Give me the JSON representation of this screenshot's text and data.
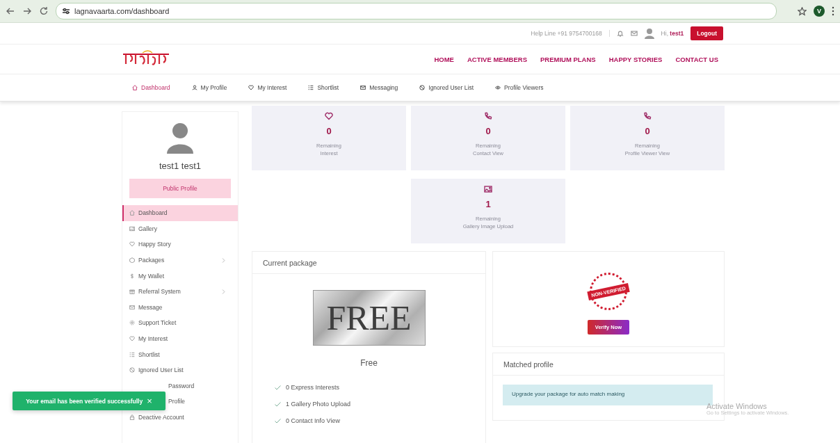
{
  "browser": {
    "url": "lagnavaarta.com/dashboard",
    "profile_initial": "V"
  },
  "top_bar": {
    "helpline": "Help Line +91 9754700168",
    "greeting": "Hi, ",
    "username": "test1",
    "logout": "Logout"
  },
  "nav": {
    "links": [
      "HOME",
      "ACTIVE MEMBERS",
      "PREMIUM PLANS",
      "HAPPY STORIES",
      "CONTACT US"
    ]
  },
  "sub_nav": [
    {
      "label": "Dashboard",
      "selected": true
    },
    {
      "label": "My Profile",
      "selected": false
    },
    {
      "label": "My Interest",
      "selected": false
    },
    {
      "label": "Shortlist",
      "selected": false
    },
    {
      "label": "Messaging",
      "selected": false
    },
    {
      "label": "Ignored User List",
      "selected": false
    },
    {
      "label": "Profile Viewers",
      "selected": false
    }
  ],
  "sidebar": {
    "name": "test1 test1",
    "public_profile": "Public Profile",
    "items": [
      {
        "label": "Dashboard",
        "selected": true,
        "has_submenu": false
      },
      {
        "label": "Gallery",
        "selected": false,
        "has_submenu": false
      },
      {
        "label": "Happy Story",
        "selected": false,
        "has_submenu": false
      },
      {
        "label": "Packages",
        "selected": false,
        "has_submenu": true
      },
      {
        "label": "My Wallet",
        "selected": false,
        "has_submenu": false
      },
      {
        "label": "Referral System",
        "selected": false,
        "has_submenu": true
      },
      {
        "label": "Message",
        "selected": false,
        "has_submenu": false
      },
      {
        "label": "Support Ticket",
        "selected": false,
        "has_submenu": false
      },
      {
        "label": "My Interest",
        "selected": false,
        "has_submenu": false
      },
      {
        "label": "Shortlist",
        "selected": false,
        "has_submenu": false
      },
      {
        "label": "Ignored User List",
        "selected": false,
        "has_submenu": false
      },
      {
        "label": "Password",
        "selected": false,
        "has_submenu": false,
        "covered": true
      },
      {
        "label": "Profile",
        "selected": false,
        "has_submenu": false,
        "covered": true
      },
      {
        "label": "Deactive Account",
        "selected": false,
        "has_submenu": false
      }
    ]
  },
  "stats": [
    {
      "value": "0",
      "line1": "Remaining",
      "line2": "Interest"
    },
    {
      "value": "0",
      "line1": "Remaining",
      "line2": "Contact View"
    },
    {
      "value": "0",
      "line1": "Remaining",
      "line2": "Profile Viewer View"
    },
    {
      "value": "1",
      "line1": "Remaining",
      "line2": "Gallery Image Upload"
    }
  ],
  "current_package": {
    "title": "Current package",
    "badge": "FREE",
    "name": "Free",
    "features": [
      "0 Express Interests",
      "1 Gallery Photo Upload",
      "0 Contact Info View"
    ]
  },
  "verification": {
    "stamp": "NON-VERIFIED",
    "button": "Verify Now"
  },
  "matched_profile": {
    "title": "Matched profile",
    "notice": "Upgrade your package for auto match making"
  },
  "toast": {
    "message": "Your email has been verified successfully",
    "close": "×"
  },
  "os_notice": {
    "title": "Activate Windows",
    "subtitle": "Go to Settings to activate Windows."
  }
}
